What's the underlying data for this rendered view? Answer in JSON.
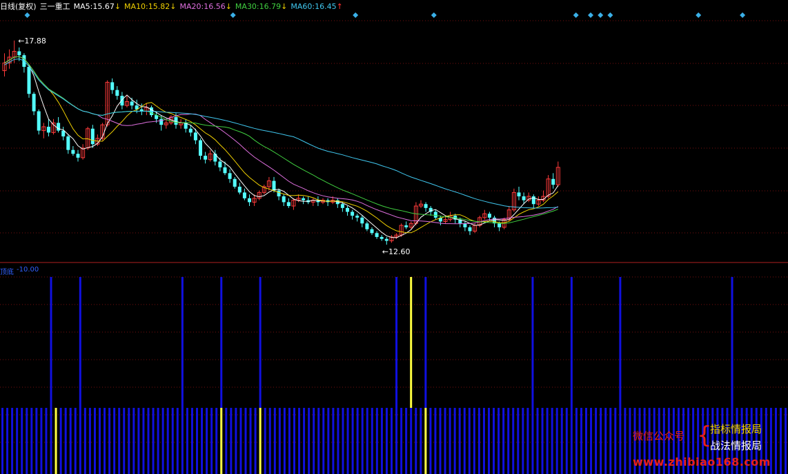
{
  "header": {
    "period": "日线(复权)",
    "stock": "三一重工",
    "ma": [
      {
        "label": "MA5:",
        "value": "15.67",
        "arrow": "↓",
        "color": "#ffffff",
        "arrow_color": "#f0d000"
      },
      {
        "label": "MA10:",
        "value": "15.82",
        "arrow": "↓",
        "color": "#f0d000",
        "arrow_color": "#f0d000"
      },
      {
        "label": "MA20:",
        "value": "16.56",
        "arrow": "↓",
        "color": "#e070e0",
        "arrow_color": "#f0d000"
      },
      {
        "label": "MA30:",
        "value": "16.79",
        "arrow": "↓",
        "color": "#40d040",
        "arrow_color": "#f0d000"
      },
      {
        "label": "MA60:",
        "value": "16.45",
        "arrow": "↑",
        "color": "#40c8f0",
        "arrow_color": "#ff3030"
      }
    ]
  },
  "indicator": {
    "name": "顶底",
    "value": "-10.00"
  },
  "watermark": {
    "wechat": "微信公众号",
    "brace": "{",
    "line1": "指标情报局",
    "line2": "战法情报局",
    "url": "www.zhibiao168.com"
  },
  "colors": {
    "up": "#ff3b3b",
    "down": "#54ffff",
    "grid": "#7a1010",
    "separator": "#b02020",
    "marker": "#3ab0e8",
    "bar_blue": "#1010e0",
    "bar_yellow": "#ffff40"
  },
  "chart_data": [
    {
      "type": "candlestick",
      "annotations": [
        {
          "text": "17.88",
          "value": 17.88
        },
        {
          "text": "12.60",
          "value": 12.6
        }
      ],
      "y_range": [
        12.3,
        18.5
      ],
      "n": 114,
      "candles": [
        [
          17.1,
          17.3,
          17.55,
          16.95
        ],
        [
          17.3,
          17.45,
          17.65,
          17.15
        ],
        [
          17.45,
          17.6,
          17.88,
          17.3
        ],
        [
          17.6,
          17.5,
          17.7,
          17.35
        ],
        [
          17.5,
          17.2,
          17.55,
          17.05
        ],
        [
          17.2,
          16.5,
          17.25,
          16.4
        ],
        [
          16.5,
          16.05,
          16.55,
          15.95
        ],
        [
          16.05,
          15.55,
          16.1,
          15.45
        ],
        [
          15.55,
          15.65,
          15.75,
          15.35
        ],
        [
          15.65,
          15.5,
          15.85,
          15.4
        ],
        [
          15.5,
          15.75,
          15.85,
          15.45
        ],
        [
          15.75,
          15.55,
          15.9,
          15.5
        ],
        [
          15.55,
          15.4,
          15.65,
          15.3
        ],
        [
          15.4,
          15.05,
          15.45,
          14.95
        ],
        [
          15.05,
          14.95,
          15.15,
          14.9
        ],
        [
          14.95,
          14.85,
          15.05,
          14.75
        ],
        [
          14.85,
          15.1,
          15.2,
          14.8
        ],
        [
          15.1,
          15.6,
          15.65,
          15.05
        ],
        [
          15.6,
          15.2,
          15.7,
          15.1
        ],
        [
          15.2,
          15.35,
          15.45,
          15.15
        ],
        [
          15.35,
          15.7,
          15.75,
          15.3
        ],
        [
          15.7,
          16.8,
          16.85,
          15.65
        ],
        [
          16.8,
          16.6,
          16.9,
          16.5
        ],
        [
          16.6,
          16.45,
          16.7,
          16.35
        ],
        [
          16.45,
          16.2,
          16.55,
          16.1
        ],
        [
          16.2,
          16.3,
          16.45,
          16.15
        ],
        [
          16.3,
          16.2,
          16.4,
          16.1
        ],
        [
          16.2,
          16.1,
          16.35,
          16.0
        ],
        [
          16.1,
          16.05,
          16.25,
          15.95
        ],
        [
          16.05,
          16.15,
          16.25,
          15.95
        ],
        [
          16.15,
          15.95,
          16.2,
          15.9
        ],
        [
          15.95,
          15.85,
          16.05,
          15.75
        ],
        [
          15.85,
          15.7,
          15.95,
          15.55
        ],
        [
          15.7,
          15.75,
          15.85,
          15.6
        ],
        [
          15.75,
          15.9,
          15.95,
          15.7
        ],
        [
          15.9,
          15.7,
          16.0,
          15.6
        ],
        [
          15.7,
          15.75,
          15.85,
          15.6
        ],
        [
          15.75,
          15.6,
          15.85,
          15.5
        ],
        [
          15.6,
          15.5,
          15.7,
          15.4
        ],
        [
          15.5,
          15.3,
          15.6,
          15.2
        ],
        [
          15.3,
          14.9,
          15.35,
          14.8
        ],
        [
          14.9,
          14.8,
          15.0,
          14.7
        ],
        [
          14.8,
          14.95,
          15.05,
          14.75
        ],
        [
          14.95,
          14.75,
          15.05,
          14.65
        ],
        [
          14.75,
          14.6,
          14.85,
          14.5
        ],
        [
          14.6,
          14.45,
          14.75,
          14.4
        ],
        [
          14.45,
          14.3,
          14.55,
          14.2
        ],
        [
          14.3,
          14.1,
          14.35,
          14.05
        ],
        [
          14.1,
          13.95,
          14.2,
          13.9
        ],
        [
          13.95,
          13.8,
          14.05,
          13.75
        ],
        [
          13.8,
          13.7,
          13.9,
          13.6
        ],
        [
          13.7,
          13.8,
          13.9,
          13.6
        ],
        [
          13.8,
          13.95,
          14.0,
          13.75
        ],
        [
          13.95,
          14.1,
          14.15,
          13.9
        ],
        [
          14.1,
          14.25,
          14.35,
          14.0
        ],
        [
          14.25,
          14.0,
          14.35,
          13.95
        ],
        [
          14.0,
          13.85,
          14.05,
          13.75
        ],
        [
          13.85,
          13.7,
          13.9,
          13.6
        ],
        [
          13.7,
          13.6,
          13.8,
          13.55
        ],
        [
          13.6,
          13.75,
          13.8,
          13.5
        ],
        [
          13.75,
          13.8,
          13.9,
          13.7
        ],
        [
          13.8,
          13.75,
          13.85,
          13.65
        ],
        [
          13.75,
          13.7,
          13.85,
          13.65
        ],
        [
          13.7,
          13.75,
          13.8,
          13.6
        ],
        [
          13.75,
          13.7,
          13.85,
          13.6
        ],
        [
          13.7,
          13.75,
          13.8,
          13.65
        ],
        [
          13.75,
          13.7,
          13.8,
          13.6
        ],
        [
          13.7,
          13.75,
          13.85,
          13.65
        ],
        [
          13.75,
          13.65,
          13.8,
          13.55
        ],
        [
          13.65,
          13.55,
          13.7,
          13.45
        ],
        [
          13.55,
          13.45,
          13.6,
          13.35
        ],
        [
          13.45,
          13.35,
          13.5,
          13.25
        ],
        [
          13.35,
          13.3,
          13.4,
          13.2
        ],
        [
          13.3,
          13.15,
          13.35,
          13.05
        ],
        [
          13.15,
          13.0,
          13.2,
          12.95
        ],
        [
          13.0,
          12.9,
          13.05,
          12.85
        ],
        [
          12.9,
          12.8,
          12.95,
          12.75
        ],
        [
          12.8,
          12.75,
          12.85,
          12.7
        ],
        [
          12.75,
          12.7,
          12.8,
          12.6
        ],
        [
          12.7,
          12.8,
          12.85,
          12.65
        ],
        [
          12.8,
          12.85,
          12.9,
          12.75
        ],
        [
          12.85,
          13.1,
          13.15,
          12.8
        ],
        [
          13.1,
          13.05,
          13.2,
          13.0
        ],
        [
          13.05,
          13.15,
          13.2,
          13.0
        ],
        [
          13.15,
          13.6,
          13.7,
          13.1
        ],
        [
          13.6,
          13.65,
          13.75,
          13.55
        ],
        [
          13.65,
          13.55,
          13.7,
          13.45
        ],
        [
          13.55,
          13.45,
          13.6,
          13.35
        ],
        [
          13.45,
          13.3,
          13.5,
          13.25
        ],
        [
          13.3,
          13.2,
          13.35,
          13.1
        ],
        [
          13.2,
          13.25,
          13.35,
          13.15
        ],
        [
          13.25,
          13.35,
          13.45,
          13.2
        ],
        [
          13.35,
          13.25,
          13.4,
          13.15
        ],
        [
          13.25,
          13.15,
          13.3,
          13.05
        ],
        [
          13.15,
          13.05,
          13.2,
          12.95
        ],
        [
          13.05,
          12.95,
          13.1,
          12.85
        ],
        [
          12.95,
          13.1,
          13.15,
          12.9
        ],
        [
          13.1,
          13.3,
          13.35,
          13.05
        ],
        [
          13.3,
          13.4,
          13.5,
          13.25
        ],
        [
          13.4,
          13.3,
          13.45,
          13.2
        ],
        [
          13.3,
          13.15,
          13.35,
          13.05
        ],
        [
          13.15,
          13.05,
          13.2,
          12.95
        ],
        [
          13.05,
          13.25,
          13.3,
          13.0
        ],
        [
          13.25,
          13.5,
          13.6,
          13.2
        ],
        [
          13.5,
          13.95,
          14.05,
          13.45
        ],
        [
          13.95,
          13.85,
          14.1,
          13.75
        ],
        [
          13.85,
          13.75,
          13.95,
          13.65
        ],
        [
          13.75,
          13.85,
          13.95,
          13.7
        ],
        [
          13.85,
          13.65,
          13.9,
          13.55
        ],
        [
          13.65,
          13.75,
          13.85,
          13.6
        ],
        [
          13.75,
          13.85,
          14.0,
          13.7
        ],
        [
          13.85,
          14.3,
          14.4,
          13.8
        ],
        [
          14.3,
          14.15,
          14.45,
          14.05
        ],
        [
          14.15,
          14.6,
          14.75,
          14.1
        ]
      ],
      "ma": [
        {
          "name": "MA5",
          "color": "#ffffff",
          "start": 0
        },
        {
          "name": "MA10",
          "color": "#f0d000",
          "start": 0
        },
        {
          "name": "MA20",
          "color": "#e070e0",
          "start": 0
        },
        {
          "name": "MA30",
          "color": "#40d040",
          "start": 0
        },
        {
          "name": "MA60",
          "color": "#40c8f0",
          "start": 0
        }
      ],
      "markers": [
        5,
        47,
        72,
        88,
        117,
        120,
        122,
        124,
        142,
        151
      ]
    },
    {
      "type": "bar",
      "value": -10.0,
      "full_bars": [
        {
          "i": 10,
          "c": "b"
        },
        {
          "i": 16,
          "c": "b"
        },
        {
          "i": 37,
          "c": "b"
        },
        {
          "i": 45,
          "c": "b"
        },
        {
          "i": 53,
          "c": "b"
        },
        {
          "i": 81,
          "c": "b"
        },
        {
          "i": 84,
          "c": "y"
        },
        {
          "i": 87,
          "c": "b"
        },
        {
          "i": 109,
          "c": "b"
        },
        {
          "i": 117,
          "c": "b"
        },
        {
          "i": 127,
          "c": "b"
        },
        {
          "i": 150,
          "c": "b"
        }
      ],
      "short_yellow": [
        11,
        45,
        53,
        87
      ]
    }
  ]
}
